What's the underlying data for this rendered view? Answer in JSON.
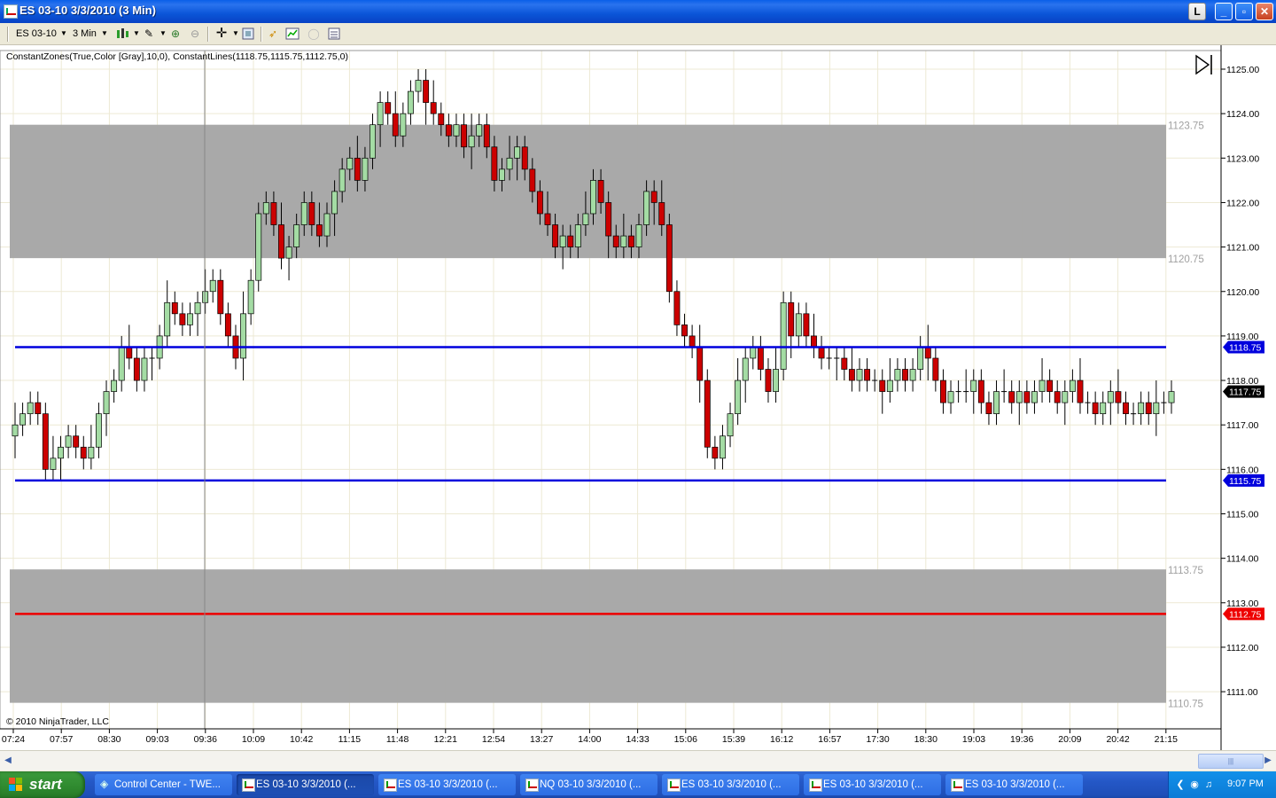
{
  "window": {
    "title": "ES 03-10  3/3/2010 (3 Min)",
    "buttons": [
      "L",
      "_",
      "▫",
      "✕"
    ]
  },
  "toolbar": {
    "instrument": "ES 03-10",
    "interval": "3 Min"
  },
  "chart": {
    "indicator_label": "ConstantZones(True,Color [Gray],10,0), ConstantLines(1118.75,1115.75,1112.75,0)",
    "copyright": "© 2010 NinjaTrader, LLC",
    "colors": {
      "zone": "#a6a6a6",
      "line_blue": "#0000dd",
      "line_red": "#ee0000",
      "up": "#a4dca4",
      "down": "#cc0000",
      "grid": "#ede9d4"
    }
  },
  "chart_data": {
    "type": "candlestick",
    "y_ticks": [
      "1125.00",
      "1124.00",
      "1123.00",
      "1122.00",
      "1121.00",
      "1120.00",
      "1119.00",
      "1118.00",
      "1117.00",
      "1116.00",
      "1115.00",
      "1114.00",
      "1113.00",
      "1112.00",
      "1111.00"
    ],
    "x_ticks": [
      "07:24",
      "07:57",
      "08:30",
      "09:03",
      "09:36",
      "10:09",
      "10:42",
      "11:15",
      "11:48",
      "12:21",
      "12:54",
      "13:27",
      "14:00",
      "14:33",
      "15:06",
      "15:39",
      "16:12",
      "16:57",
      "17:30",
      "18:30",
      "19:03",
      "19:36",
      "20:09",
      "20:42",
      "21:15"
    ],
    "zones": [
      {
        "top": 1123.75,
        "bottom": 1120.75,
        "top_label": "1123.75",
        "bottom_label": "1120.75"
      },
      {
        "top": 1113.75,
        "bottom": 1110.75,
        "top_label": "1113.75",
        "bottom_label": "1110.75"
      }
    ],
    "lines": [
      {
        "value": 1118.75,
        "label": "1118.75",
        "color": "#0000dd"
      },
      {
        "value": 1115.75,
        "label": "1115.75",
        "color": "#0000dd"
      },
      {
        "value": 1112.75,
        "label": "1112.75",
        "color": "#ee0000"
      }
    ],
    "last_price": {
      "value": 1117.75,
      "label": "1117.75"
    },
    "closes": [
      1117.0,
      1117.25,
      1117.5,
      1117.25,
      1116.0,
      1116.25,
      1116.5,
      1116.75,
      1116.5,
      1116.25,
      1116.5,
      1117.25,
      1117.75,
      1118.0,
      1118.75,
      1118.5,
      1118.0,
      1118.5,
      1118.5,
      1119.0,
      1119.75,
      1119.5,
      1119.25,
      1119.5,
      1119.75,
      1120.0,
      1120.25,
      1119.5,
      1119.0,
      1118.5,
      1119.5,
      1120.25,
      1121.75,
      1122.0,
      1121.5,
      1120.75,
      1121.0,
      1121.5,
      1122.0,
      1121.5,
      1121.25,
      1121.75,
      1122.25,
      1122.75,
      1123.0,
      1122.5,
      1123.0,
      1123.75,
      1124.25,
      1124.0,
      1123.5,
      1124.0,
      1124.5,
      1124.75,
      1124.25,
      1124.0,
      1123.75,
      1123.5,
      1123.75,
      1123.25,
      1123.5,
      1123.75,
      1123.25,
      1122.5,
      1122.75,
      1123.0,
      1123.25,
      1122.75,
      1122.25,
      1121.75,
      1121.5,
      1121.0,
      1121.25,
      1121.0,
      1121.5,
      1121.75,
      1122.5,
      1122.0,
      1121.25,
      1121.0,
      1121.25,
      1121.0,
      1121.5,
      1122.25,
      1122.0,
      1121.5,
      1120.0,
      1119.25,
      1119.0,
      1118.75,
      1118.0,
      1116.5,
      1116.25,
      1116.75,
      1117.25,
      1118.0,
      1118.5,
      1118.75,
      1118.25,
      1117.75,
      1118.25,
      1119.75,
      1119.0,
      1119.5,
      1119.0,
      1118.75,
      1118.5,
      1118.5,
      1118.5,
      1118.25,
      1118.0,
      1118.25,
      1118.0,
      1118.0,
      1117.75,
      1118.0,
      1118.25,
      1118.0,
      1118.25,
      1118.75,
      1118.5,
      1118.0,
      1117.5,
      1117.75,
      1117.75,
      1117.75,
      1118.0,
      1117.5,
      1117.25,
      1117.75,
      1117.75,
      1117.5,
      1117.75,
      1117.5,
      1117.75,
      1118.0,
      1117.75,
      1117.5,
      1117.75,
      1118.0,
      1117.5,
      1117.5,
      1117.25,
      1117.5,
      1117.75,
      1117.5,
      1117.25,
      1117.25,
      1117.5,
      1117.25,
      1117.5,
      1117.5,
      1117.75
    ]
  },
  "taskbar": {
    "start_label": "start",
    "tasks": [
      {
        "label": "Control Center - TWE...",
        "active": false,
        "icon": "control-center-icon"
      },
      {
        "label": "ES 03-10  3/3/2010 (...",
        "active": true,
        "icon": "chart-icon"
      },
      {
        "label": "ES 03-10  3/3/2010 (...",
        "active": false,
        "icon": "chart-icon"
      },
      {
        "label": "NQ 03-10  3/3/2010 (...",
        "active": false,
        "icon": "chart-icon"
      },
      {
        "label": "ES 03-10  3/3/2010 (...",
        "active": false,
        "icon": "chart-icon"
      },
      {
        "label": "ES 03-10  3/3/2010 (...",
        "active": false,
        "icon": "chart-icon"
      },
      {
        "label": "ES 03-10  3/3/2010 (...",
        "active": false,
        "icon": "chart-icon"
      }
    ],
    "clock": "9:07 PM"
  }
}
